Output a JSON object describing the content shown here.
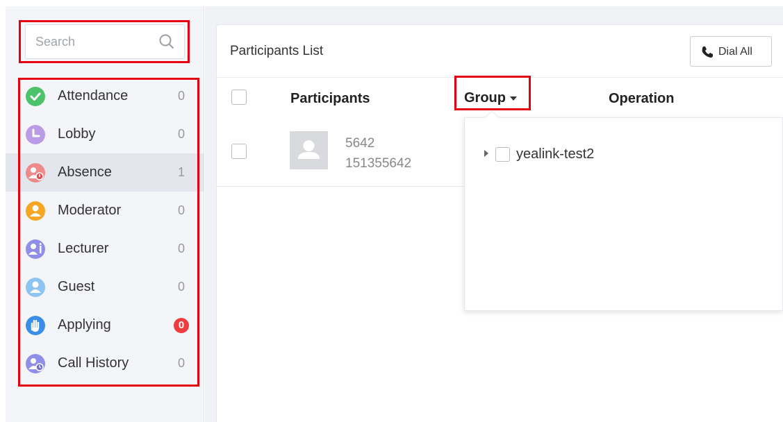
{
  "search": {
    "placeholder": "Search"
  },
  "sidebar": {
    "items": [
      {
        "label": "Attendance",
        "count": "0",
        "icon": "check-icon",
        "color": "#4cc36b"
      },
      {
        "label": "Lobby",
        "count": "0",
        "icon": "clock-icon",
        "color": "#b99be6"
      },
      {
        "label": "Absence",
        "count": "1",
        "icon": "absent-user-icon",
        "color": "#f08a8a"
      },
      {
        "label": "Moderator",
        "count": "0",
        "icon": "moderator-icon",
        "color": "#f5a623"
      },
      {
        "label": "Lecturer",
        "count": "0",
        "icon": "lecturer-icon",
        "color": "#8f8ee8"
      },
      {
        "label": "Guest",
        "count": "0",
        "icon": "guest-icon",
        "color": "#8ec4f2"
      },
      {
        "label": "Applying",
        "count": "0",
        "icon": "hand-icon",
        "color": "#3b8ee8"
      },
      {
        "label": "Call History",
        "count": "0",
        "icon": "call-history-icon",
        "color": "#8f8ee8"
      }
    ]
  },
  "panel": {
    "title": "Participants List",
    "dial_all_label": "Dial All",
    "columns": [
      "Participants",
      "Group",
      "Operation"
    ],
    "participants": [
      {
        "name": "5642",
        "number": "151355642"
      }
    ]
  },
  "group_dropdown": {
    "items": [
      {
        "label": "yealink-test2"
      }
    ]
  },
  "colors": {
    "highlight": "#e6000f",
    "badge": "#f03c3c"
  }
}
